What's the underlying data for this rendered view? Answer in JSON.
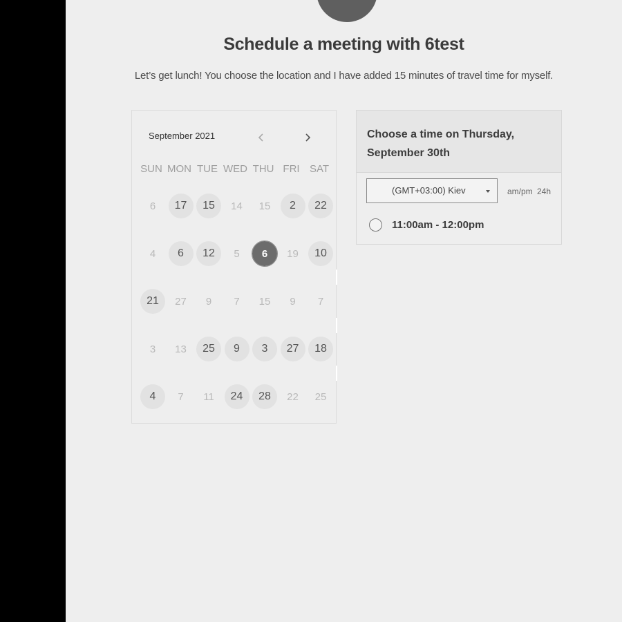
{
  "page": {
    "title": "Schedule a meeting with 6test",
    "subtitle": "Let’s get lunch! You choose the location and I have added 15 minutes of travel time for myself."
  },
  "calendar": {
    "month_label": "September 2021",
    "prev_icon": "chevron-left-icon",
    "next_icon": "chevron-right-icon",
    "weekdays": [
      "SUN",
      "MON",
      "TUE",
      "WED",
      "THU",
      "FRI",
      "SAT"
    ],
    "weeks": [
      [
        {
          "label": "6",
          "state": "disabled"
        },
        {
          "label": "17",
          "state": "available"
        },
        {
          "label": "15",
          "state": "available"
        },
        {
          "label": "14",
          "state": "disabled"
        },
        {
          "label": "15",
          "state": "disabled"
        },
        {
          "label": "2",
          "state": "available"
        },
        {
          "label": "22",
          "state": "available"
        }
      ],
      [
        {
          "label": "4",
          "state": "disabled"
        },
        {
          "label": "6",
          "state": "available"
        },
        {
          "label": "12",
          "state": "available"
        },
        {
          "label": "5",
          "state": "disabled"
        },
        {
          "label": "6",
          "state": "selected"
        },
        {
          "label": "19",
          "state": "disabled"
        },
        {
          "label": "10",
          "state": "available"
        }
      ],
      [
        {
          "label": "21",
          "state": "available"
        },
        {
          "label": "27",
          "state": "disabled"
        },
        {
          "label": "9",
          "state": "disabled"
        },
        {
          "label": "7",
          "state": "disabled"
        },
        {
          "label": "15",
          "state": "disabled"
        },
        {
          "label": "9",
          "state": "disabled"
        },
        {
          "label": "7",
          "state": "disabled"
        }
      ],
      [
        {
          "label": "3",
          "state": "disabled"
        },
        {
          "label": "13",
          "state": "disabled"
        },
        {
          "label": "25",
          "state": "available"
        },
        {
          "label": "9",
          "state": "available"
        },
        {
          "label": "3",
          "state": "available"
        },
        {
          "label": "27",
          "state": "available"
        },
        {
          "label": "18",
          "state": "available"
        }
      ],
      [
        {
          "label": "4",
          "state": "available"
        },
        {
          "label": "7",
          "state": "disabled"
        },
        {
          "label": "11",
          "state": "disabled"
        },
        {
          "label": "24",
          "state": "available"
        },
        {
          "label": "28",
          "state": "available"
        },
        {
          "label": "22",
          "state": "disabled"
        },
        {
          "label": "25",
          "state": "disabled"
        }
      ]
    ]
  },
  "timepanel": {
    "heading": "Choose a time on Thursday, September 30th",
    "timezone_value": "(GMT+03:00) Kiev",
    "format_ampm": "am/pm",
    "format_24h": "24h",
    "slots": [
      {
        "label": "11:00am - 12:00pm"
      }
    ]
  },
  "colors": {
    "page_bg": "#eeeeee",
    "selected_day": "#6c6c6c",
    "available_day": "#e2e2e2"
  }
}
